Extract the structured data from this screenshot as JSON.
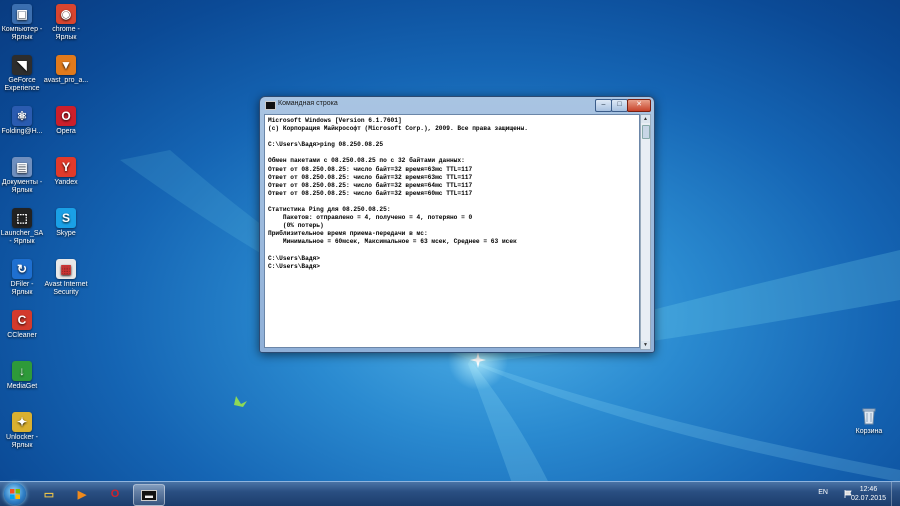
{
  "desktop": {
    "icons_left": [
      {
        "label": "Компьютер -\nЯрлык",
        "icon": "computer-icon",
        "color": "#3b6fb0",
        "glyph": "▣"
      },
      {
        "label": "GeForce\nExperience",
        "icon": "geforce-icon",
        "color": "#2d2d2d",
        "glyph": "◥"
      },
      {
        "label": "Folding@H...",
        "icon": "folding-icon",
        "color": "#2a5bb0",
        "glyph": "⚛"
      },
      {
        "label": "Документы -\nЯрлык",
        "icon": "documents-icon",
        "color": "#6f8fbf",
        "glyph": "▤"
      },
      {
        "label": "Launcher_SA\n- Ярлык",
        "icon": "launcher-icon",
        "color": "#222222",
        "glyph": "⬚"
      },
      {
        "label": "DFiler -\nЯрлык",
        "icon": "dfiler-icon",
        "color": "#1e6fd0",
        "glyph": "↻"
      },
      {
        "label": "CCleaner",
        "icon": "ccleaner-icon",
        "color": "#d33a2c",
        "glyph": "C"
      },
      {
        "label": "MediaGet",
        "icon": "mediaget-icon",
        "color": "#2e9a3a",
        "glyph": "↓"
      },
      {
        "label": "Unlocker -\nЯрлык",
        "icon": "unlocker-icon",
        "color": "#d9b030",
        "glyph": "✦"
      }
    ],
    "icons_right_col": [
      {
        "label": "chrome -\nЯрлык",
        "icon": "chrome-icon",
        "color": "#d8452f",
        "glyph": "◉"
      },
      {
        "label": "avast_pro_a...",
        "icon": "avast-pro-icon",
        "color": "#e07a1c",
        "glyph": "▼"
      },
      {
        "label": "Opera",
        "icon": "opera-icon",
        "color": "#cc1f2b",
        "glyph": "O"
      },
      {
        "label": "Yandex",
        "icon": "yandex-icon",
        "color": "#e13a2a",
        "glyph": "Y"
      },
      {
        "label": "Skype",
        "icon": "skype-icon",
        "color": "#1aa0e6",
        "glyph": "S"
      },
      {
        "label": "Avast Internet\nSecurity",
        "icon": "avast-is-icon",
        "color": "#e8e8e8",
        "glyph": "▦"
      }
    ],
    "recycle": {
      "label": "Корзина",
      "icon": "recycle-bin-icon"
    }
  },
  "cmd": {
    "title": "Командная строка",
    "controls": {
      "minimize": "‒",
      "maximize": "□",
      "close": "✕"
    },
    "lines": [
      "Microsoft Windows [Version 6.1.7601]",
      "(c) Корпорация Майкрософт (Microsoft Corp.), 2009. Все права защищены.",
      "",
      "C:\\Users\\Вадя>ping 08.250.08.25",
      "",
      "Обмен пакетами с 08.250.08.25 по с 32 байтами данных:",
      "Ответ от 08.250.08.25: число байт=32 время=63мс TTL=117",
      "Ответ от 08.250.08.25: число байт=32 время=63мс TTL=117",
      "Ответ от 08.250.08.25: число байт=32 время=64мс TTL=117",
      "Ответ от 08.250.08.25: число байт=32 время=60мс TTL=117",
      "",
      "Статистика Ping для 08.250.08.25:",
      "    Пакетов: отправлено = 4, получено = 4, потеряно = 0",
      "    (0% потерь)",
      "Приблизительное время приема-передачи в мс:",
      "    Минимальное = 60мсек, Максимальное = 63 мсек, Среднее = 63 мсек",
      "",
      "C:\\Users\\Вадя>",
      "C:\\Users\\Вадя>"
    ]
  },
  "taskbar": {
    "pinned": [
      {
        "name": "explorer-icon",
        "glyph": "▭",
        "color": "#e9c24a"
      },
      {
        "name": "media-player-icon",
        "glyph": "▶",
        "color": "#f08a1c"
      },
      {
        "name": "opera-taskbar-icon",
        "glyph": "O",
        "color": "#d2222b"
      },
      {
        "name": "cmd-taskbar-icon",
        "glyph": "▬",
        "color": "#f0f0f0"
      }
    ],
    "lang": "EN",
    "time": "12:46",
    "date": "02.07.2015"
  }
}
